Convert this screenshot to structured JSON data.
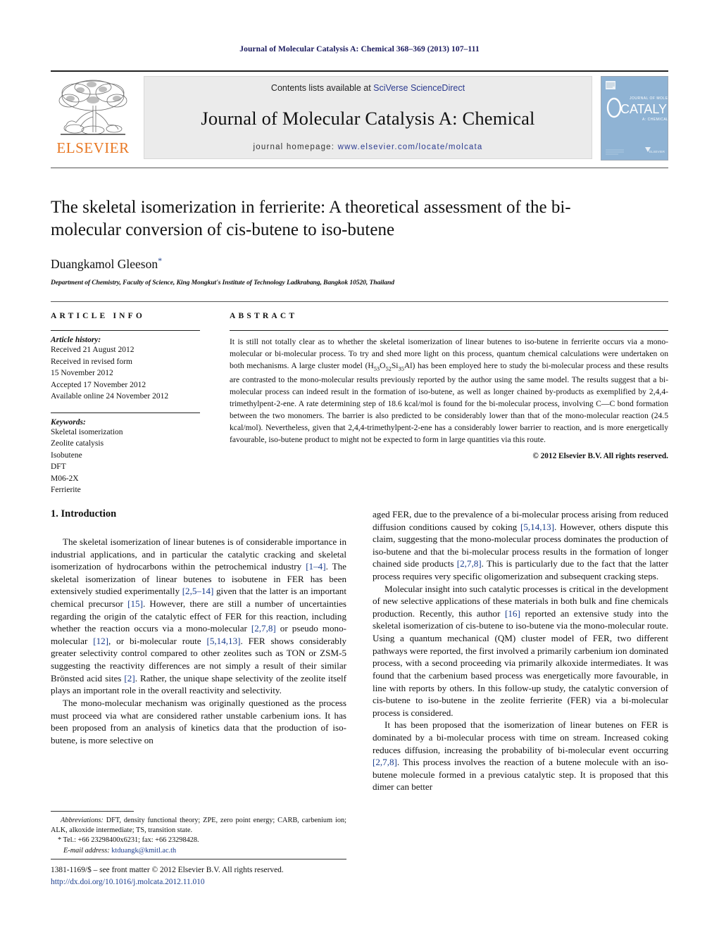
{
  "running_head": "Journal of Molecular Catalysis A: Chemical 368–369 (2013) 107–111",
  "masthead": {
    "publisher_name": "ELSEVIER",
    "contents_prefix": "Contents lists available at ",
    "contents_link": "SciVerse ScienceDirect",
    "journal_title": "Journal of Molecular Catalysis A: Chemical",
    "homepage_label": "journal homepage: ",
    "homepage_url": "www.elsevier.com/locate/molcata",
    "cover_title_top": "JOURNAL OF MOLECULAR",
    "cover_title_main": "CATALYSIS",
    "cover_title_sub": "A: CHEMICAL",
    "cover_footer": "ELSEVIER"
  },
  "article": {
    "title": "The skeletal isomerization in ferrierite: A theoretical assessment of the bi-molecular conversion of cis-butene to iso-butene",
    "author": "Duangkamol Gleeson",
    "author_marker": "*",
    "affiliation": "Department of Chemistry, Faculty of Science, King Mongkut's Institute of Technology Ladkrabang, Bangkok 10520, Thailand"
  },
  "article_info": {
    "heading": "ARTICLE INFO",
    "history_label": "Article history:",
    "history": [
      "Received 21 August 2012",
      "Received in revised form",
      "15 November 2012",
      "Accepted 17 November 2012",
      "Available online 24 November 2012"
    ],
    "keywords_label": "Keywords:",
    "keywords": [
      "Skeletal isomerization",
      "Zeolite catalysis",
      "Isobutene",
      "DFT",
      "M06-2X",
      "Ferrierite"
    ]
  },
  "abstract": {
    "heading": "ABSTRACT",
    "text_part1": "It is still not totally clear as to whether the skeletal isomerization of linear butenes to iso-butene in ferrierite occurs via a mono-molecular or bi-molecular process. To try and shed more light on this process, quantum chemical calculations were undertaken on both mechanisms. A large cluster model (H",
    "formula_h": "53",
    "formula_mid": "O",
    "formula_o": "52",
    "formula_si": "Si",
    "formula_si_num": "35",
    "formula_tail": "Al",
    "text_part2": ") has been employed here to study the bi-molecular process and these results are contrasted to the mono-molecular results previously reported by the author using the same model. The results suggest that a bi-molecular process can indeed result in the formation of iso-butene, as well as longer chained by-products as exemplified by 2,4,4-trimethylpent-2-ene. A rate determining step of 18.6 kcal/mol is found for the bi-molecular process, involving C—C bond formation between the two monomers. The barrier is also predicted to be considerably lower than that of the mono-molecular reaction (24.5 kcal/mol). Nevertheless, given that 2,4,4-trimethylpent-2-ene has a considerably lower barrier to reaction, and is more energetically favourable, iso-butene product to might not be expected to form in large quantities via this route.",
    "copyright": "© 2012 Elsevier B.V. All rights reserved."
  },
  "body": {
    "section_heading": "1. Introduction",
    "left_paragraphs": [
      {
        "segments": [
          {
            "t": "The skeletal isomerization of linear butenes is of considerable importance in industrial applications, and in particular the catalytic cracking and skeletal isomerization of hydrocarbons within the petrochemical industry ",
            "ref": false
          },
          {
            "t": "[1–4]",
            "ref": true
          },
          {
            "t": ". The skeletal isomerization of linear butenes to isobutene in FER has been extensively studied experimentally ",
            "ref": false
          },
          {
            "t": "[2,5–14]",
            "ref": true
          },
          {
            "t": " given that the latter is an important chemical precursor ",
            "ref": false
          },
          {
            "t": "[15]",
            "ref": true
          },
          {
            "t": ". However, there are still a number of uncertainties regarding the origin of the catalytic effect of FER for this reaction, including whether the reaction occurs via a mono-molecular ",
            "ref": false
          },
          {
            "t": "[2,7,8]",
            "ref": true
          },
          {
            "t": " or pseudo mono-molecular ",
            "ref": false
          },
          {
            "t": "[12]",
            "ref": true
          },
          {
            "t": ", or bi-molecular route ",
            "ref": false
          },
          {
            "t": "[5,14,13]",
            "ref": true
          },
          {
            "t": ". FER shows considerably greater selectivity control compared to other zeolites such as TON or ZSM-5 suggesting the reactivity differences are not simply a result of their similar Brönsted acid sites ",
            "ref": false
          },
          {
            "t": "[2]",
            "ref": true
          },
          {
            "t": ". Rather, the unique shape selectivity of the zeolite itself plays an important role in the overall reactivity and selectivity.",
            "ref": false
          }
        ]
      },
      {
        "segments": [
          {
            "t": "The mono-molecular mechanism was originally questioned as the process must proceed via what are considered rather unstable carbenium ions. It has been proposed from an analysis of kinetics data that the production of iso-butene, is more selective on",
            "ref": false
          }
        ]
      }
    ],
    "right_paragraphs": [
      {
        "segments": [
          {
            "t": "aged FER, due to the prevalence of a bi-molecular process arising from reduced diffusion conditions caused by coking ",
            "ref": false
          },
          {
            "t": "[5,14,13]",
            "ref": true
          },
          {
            "t": ". However, others dispute this claim, suggesting that the mono-molecular process dominates the production of iso-butene and that the bi-molecular process results in the formation of longer chained side products ",
            "ref": false
          },
          {
            "t": "[2,7,8]",
            "ref": true
          },
          {
            "t": ". This is particularly due to the fact that the latter process requires very specific oligomerization and subsequent cracking steps.",
            "ref": false
          }
        ],
        "indent": false
      },
      {
        "segments": [
          {
            "t": "Molecular insight into such catalytic processes is critical in the development of new selective applications of these materials in both bulk and fine chemicals production. Recently, this author ",
            "ref": false
          },
          {
            "t": "[16]",
            "ref": true
          },
          {
            "t": " reported an extensive study into the skeletal isomerization of cis-butene to iso-butene via the mono-molecular route. Using a quantum mechanical (QM) cluster model of FER, two different pathways were reported, the first involved a primarily carbenium ion dominated process, with a second proceeding via primarily alkoxide intermediates. It was found that the carbenium based process was energetically more favourable, in line with reports by others. In this follow-up study, the catalytic conversion of cis-butene to iso-butene in the zeolite ferrierite (FER) via a bi-molecular process is considered.",
            "ref": false
          }
        ],
        "indent": true
      },
      {
        "segments": [
          {
            "t": "It has been proposed that the isomerization of linear butenes on FER is dominated by a bi-molecular process with time on stream. Increased coking reduces diffusion, increasing the probability of bi-molecular event occurring ",
            "ref": false
          },
          {
            "t": "[2,7,8]",
            "ref": true
          },
          {
            "t": ". This process involves the reaction of a butene molecule with an iso-butene molecule formed in a previous catalytic step. It is proposed that this dimer can better",
            "ref": false
          }
        ],
        "indent": true
      }
    ]
  },
  "footnotes": {
    "abbreviations_label": "Abbreviations:",
    "abbreviations_text": " DFT, density functional theory; ZPE, zero point energy; CARB, carbenium ion; ALK, alkoxide intermediate; TS, transition state.",
    "tel_marker": "*",
    "tel_text": "Tel.: +66 23298400x6231; fax: +66 23298428.",
    "email_label": "E-mail address:",
    "email_value": "ktduangk@kmitl.ac.th"
  },
  "footer": {
    "issn_line": "1381-1169/$ – see front matter © 2012 Elsevier B.V. All rights reserved.",
    "doi_line": "http://dx.doi.org/10.1016/j.molcata.2012.11.010"
  },
  "colors": {
    "running_head": "#1a1a5e",
    "link_blue": "#2b3a8f",
    "reference_blue": "#1a3c8c",
    "elsevier_orange": "#E87722",
    "banner_gray": "#ebebeb",
    "cover_blue": "#8fb3d4"
  }
}
